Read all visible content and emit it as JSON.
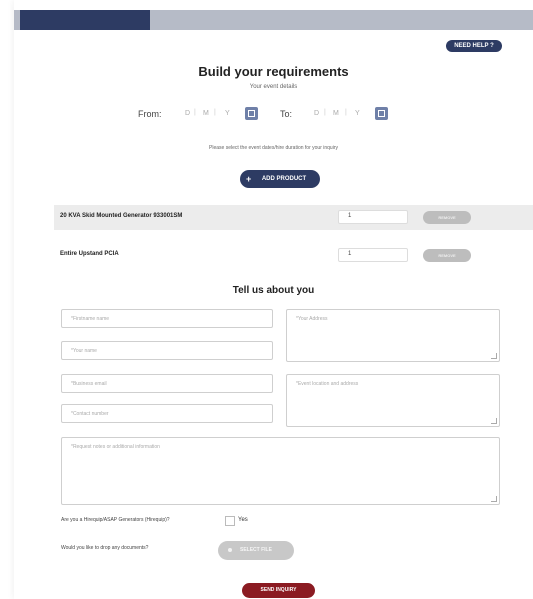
{
  "header": {
    "help_label": "NEED HELP ?"
  },
  "form": {
    "title": "Build your requirements",
    "subtitle": "Your event details",
    "from_label": "From:",
    "to_label": "To:",
    "date_parts": [
      "D",
      "M",
      "Y"
    ],
    "hint": "Please select the event dates/hire duration for your inquiry",
    "add_product_label": "ADD PRODUCT"
  },
  "products": [
    {
      "name": "20 KVA Skid Mounted Generator 933001SM",
      "qty": "1",
      "remove": "REMOVE"
    },
    {
      "name": "Entire Upstand PCIA",
      "qty": "1",
      "remove": "REMOVE"
    }
  ],
  "about": {
    "title": "Tell us about you",
    "placeholders": {
      "first_name": "*Firstname name",
      "last_name": "*Your name",
      "email": "*Business email",
      "phone": "*Contact number",
      "address": "*Your Address",
      "event_address": "*Event location and address",
      "notes": "*Request notes or additional information"
    },
    "already_customer": "Are you a Hirequip/ASAP Generators (Hirequip)?",
    "yes_label": "Yes",
    "upload_question": "Would you like to drop any documents?",
    "upload_label": "SELECT FILE",
    "send_label": "SEND INQUIRY"
  },
  "colors": {
    "navy": "#2d3b63",
    "calendar": "#6f80a8",
    "send": "#8b1b22",
    "band": "#b6bbc7"
  }
}
